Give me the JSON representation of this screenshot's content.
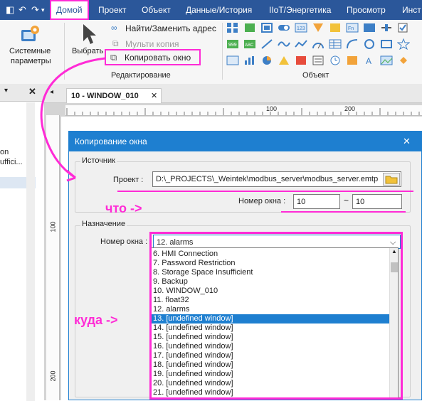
{
  "menu": {
    "home": "Домой",
    "project": "Проект",
    "object": "Объект",
    "data_history": "Данные/История",
    "iiot": "IIoT/Энергетика",
    "view": "Просмотр",
    "tools": "Инст"
  },
  "ribbon": {
    "system_params_line1": "Системные",
    "system_params_line2": "параметры",
    "select": "Выбрать",
    "find_replace": "Найти/Заменить адрес",
    "multi_copy": "Мульти копия",
    "copy_window": "Копировать окно",
    "group_edit": "Редактирование",
    "group_object": "Объект"
  },
  "left_panel": {
    "close": "✕",
    "line1": "on",
    "line2": "uffici..."
  },
  "workspace": {
    "tab_title": "10 - WINDOW_010",
    "ruler_top": [
      "100",
      "200"
    ],
    "ruler_left": [
      "100",
      "200"
    ]
  },
  "dialog": {
    "title": "Копирование окна",
    "close": "✕",
    "source_legend": "Источник",
    "project_label": "Проект :",
    "project_value": "D:\\_PROJECTS\\_Weintek\\modbus_server\\modbus_server.emtp",
    "window_no_label": "Номер окна :",
    "from_value": "10",
    "tilde": "~",
    "to_value": "10",
    "dest_legend": "Назначение",
    "dest_window_label": "Номер окна :",
    "dest_selected": "12. alarms",
    "list": [
      "6. HMI Connection",
      "7. Password Restriction",
      "8. Storage Space Insufficient",
      "9. Backup",
      "10. WINDOW_010",
      "11. float32",
      "12. alarms",
      "13. [undefined window]",
      "14. [undefined window]",
      "15. [undefined window]",
      "16. [undefined window]",
      "17. [undefined window]",
      "18. [undefined window]",
      "19. [undefined window]",
      "20. [undefined window]",
      "21. [undefined window]"
    ],
    "selected_index": 7
  },
  "annotations": {
    "what": "что ->",
    "where": "куда ->"
  },
  "colors": {
    "accent": "#2b579a",
    "dialog_blue": "#1e7fd0",
    "annotation": "#ff2bd6"
  }
}
